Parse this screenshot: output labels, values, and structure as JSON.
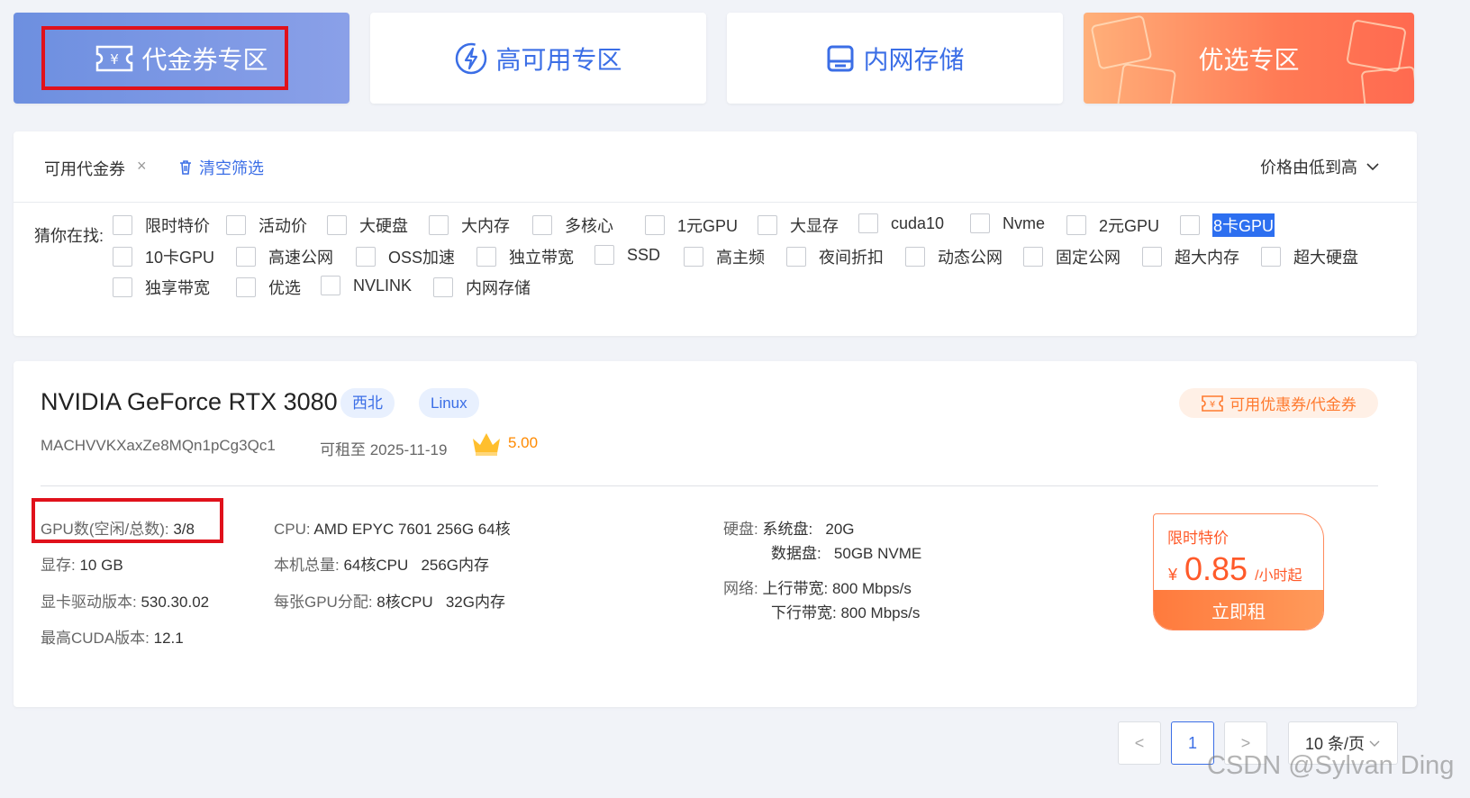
{
  "zones": [
    {
      "label": "代金券专区",
      "icon": "ticket-yen-icon"
    },
    {
      "label": "高可用专区",
      "icon": "lightning-circle-icon"
    },
    {
      "label": "内网存储",
      "icon": "storage-drive-icon"
    },
    {
      "label": "优选专区",
      "icon": "gift-icon"
    }
  ],
  "filter": {
    "active_tag": "可用代金券",
    "remove_symbol": "×",
    "clear_label": "清空筛选",
    "sort_label": "价格由低到高",
    "guess_label": "猜你在找:",
    "options": [
      "限时特价",
      "活动价",
      "大硬盘",
      "大内存",
      "多核心",
      "1元GPU",
      "大显存",
      "cuda10",
      "Nvme",
      "2元GPU",
      "8卡GPU",
      "10卡GPU",
      "高速公网",
      "OSS加速",
      "独立带宽",
      "SSD",
      "高主频",
      "夜间折扣",
      "动态公网",
      "固定公网",
      "超大内存",
      "超大硬盘",
      "独享带宽",
      "优选",
      "NVLINK",
      "内网存储"
    ]
  },
  "product": {
    "title": "NVIDIA GeForce RTX 3080",
    "region": "西北",
    "os": "Linux",
    "coupon_label": "可用优惠券/代金券",
    "machine_id": "MACHVVKXaxZe8MQn1pCg3Qc1",
    "rent_until": "可租至 2025-11-19",
    "rating": "5.00",
    "specs": {
      "gpu_count_label": "GPU数(空闲/总数):",
      "gpu_count": "3/8",
      "vram_label": "显存:",
      "vram": "10 GB",
      "driver_label": "显卡驱动版本:",
      "driver": "530.30.02",
      "cuda_label": "最高CUDA版本:",
      "cuda": "12.1",
      "cpu_label": "CPU:",
      "cpu": "AMD EPYC 7601 256G 64核",
      "total_label": "本机总量:",
      "total": "64核CPU   256G内存",
      "per_gpu_label": "每张GPU分配:",
      "per_gpu": "8核CPU   32G内存",
      "disk_label": "硬盘:",
      "sys_disk_label": "系统盘:",
      "sys_disk": "20G",
      "data_disk_label": "数据盘:",
      "data_disk": "50GB NVME",
      "net_label": "网络:",
      "up_label": "上行带宽:",
      "up": "800 Mbps/s",
      "down_label": "下行带宽:",
      "down": "800 Mbps/s"
    },
    "price": {
      "tag": "限时特价",
      "currency": "¥",
      "value": "0.85",
      "unit": "/小时起",
      "button": "立即租"
    }
  },
  "pagination": {
    "prev": "<",
    "current": "1",
    "next": ">",
    "page_size": "10 条/页"
  },
  "watermark": "CSDN @Sylvan Ding",
  "colors": {
    "accent": "#3b6ee6",
    "price": "#ff5a2a",
    "highlight_box": "#e0111b"
  }
}
